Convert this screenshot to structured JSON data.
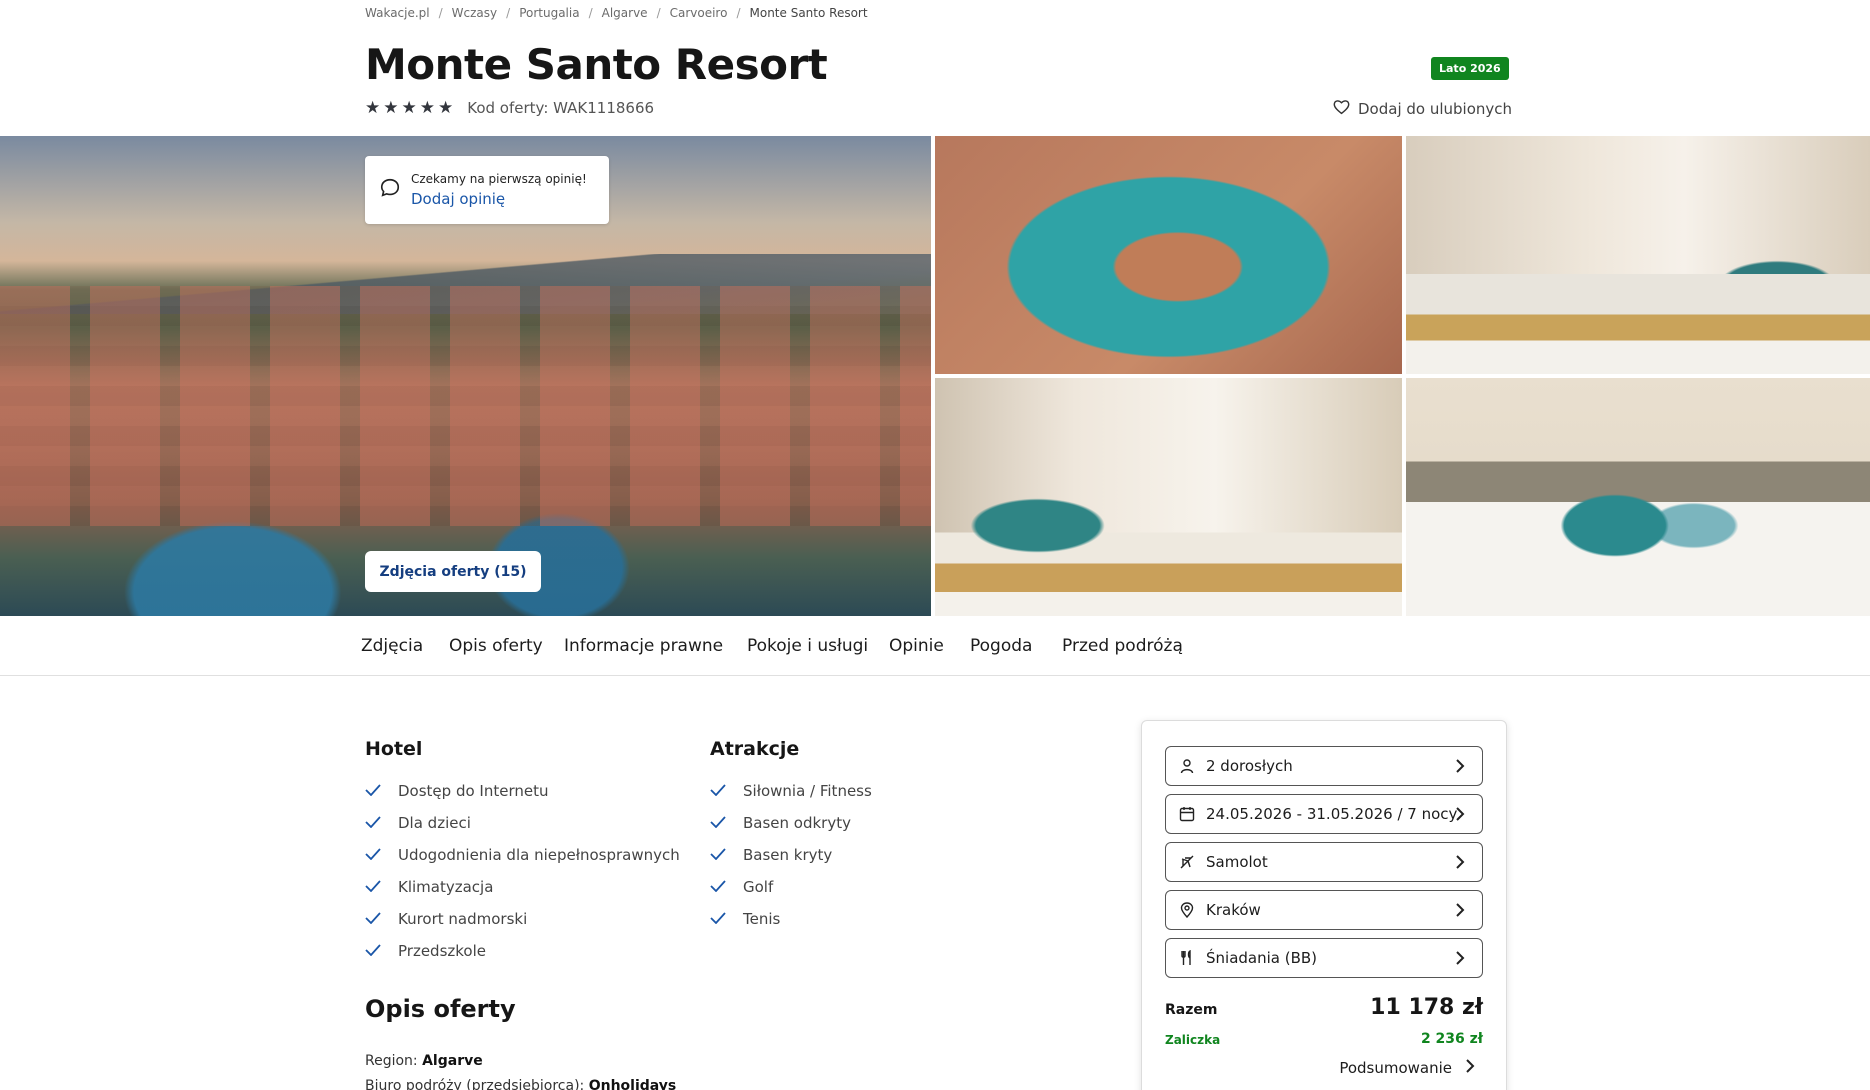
{
  "breadcrumb": [
    "Wakacje.pl",
    "Wczasy",
    "Portugalia",
    "Algarve",
    "Carvoeiro",
    "Monte Santo Resort"
  ],
  "hotel": {
    "name": "Monte Santo Resort",
    "stars": 5,
    "offer_code": "Kod oferty: WAK1118666",
    "season_badge": "Lato 2026",
    "favorite_label": "Dodaj do ulubionych"
  },
  "review": {
    "prompt": "Czekamy na pierwszą opinię!",
    "link": "Dodaj opinię"
  },
  "gallery": {
    "photos_button": "Zdjęcia oferty (15)"
  },
  "tabs": [
    "Zdjęcia",
    "Opis oferty",
    "Informacje prawne",
    "Pokoje i usługi",
    "Opinie",
    "Pogoda",
    "Przed podróżą"
  ],
  "features": {
    "hotel_title": "Hotel",
    "hotel_items": [
      "Dostęp do Internetu",
      "Dla dzieci",
      "Udogodnienia dla niepełnosprawnych",
      "Klimatyzacja",
      "Kurort nadmorski",
      "Przedszkole"
    ],
    "attractions_title": "Atrakcje",
    "attractions_items": [
      "Siłownia / Fitness",
      "Basen odkryty",
      "Basen kryty",
      "Golf",
      "Tenis"
    ]
  },
  "description": {
    "title": "Opis oferty",
    "region_label": "Region: ",
    "region_value": "Algarve",
    "agency_label": "Biuro podróży (przedsiębiorca): ",
    "agency_value": "Onholidays"
  },
  "booking": {
    "travelers": "2 dorosłych",
    "dates": "24.05.2026 - 31.05.2026 / 7 nocy",
    "transport": "Samolot",
    "departure": "Kraków",
    "board": "Śniadania (BB)",
    "total_label": "Razem",
    "total_value": "11 178 zł",
    "deposit_label": "Zaliczka",
    "deposit_value": "2 236 zł",
    "summary_label": "Podsumowanie"
  },
  "colors": {
    "accent_green": "#10851f",
    "link_blue": "#1a56a8",
    "button_navy": "#153e80"
  }
}
